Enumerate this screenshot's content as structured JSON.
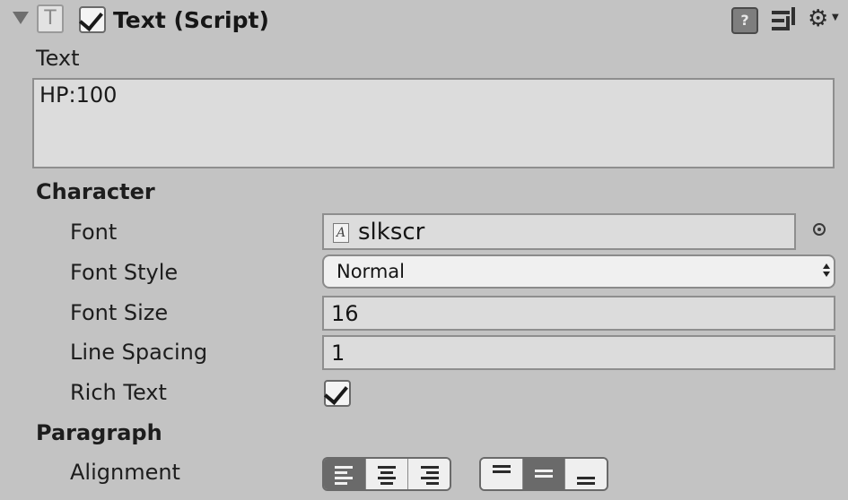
{
  "component": {
    "title": "Text (Script)",
    "enabled": true,
    "icons": [
      "text-component-icon",
      "help-icon",
      "preset-icon",
      "gear-icon"
    ]
  },
  "text_section": {
    "label": "Text",
    "value": "HP:100"
  },
  "character": {
    "heading": "Character",
    "font_label": "Font",
    "font_value": "slkscr",
    "font_style_label": "Font Style",
    "font_style_value": "Normal",
    "font_size_label": "Font Size",
    "font_size_value": "16",
    "line_spacing_label": "Line Spacing",
    "line_spacing_value": "1",
    "rich_text_label": "Rich Text",
    "rich_text_checked": true
  },
  "paragraph": {
    "heading": "Paragraph",
    "alignment_label": "Alignment",
    "horizontal_options": [
      "left",
      "center",
      "right"
    ],
    "horizontal_selected": "left",
    "vertical_options": [
      "top",
      "middle",
      "bottom"
    ],
    "vertical_selected": "middle"
  },
  "colors": {
    "panel_bg": "#c3c3c3",
    "field_bg": "#dcdcdc",
    "selected_button": "#6a6a6a"
  }
}
